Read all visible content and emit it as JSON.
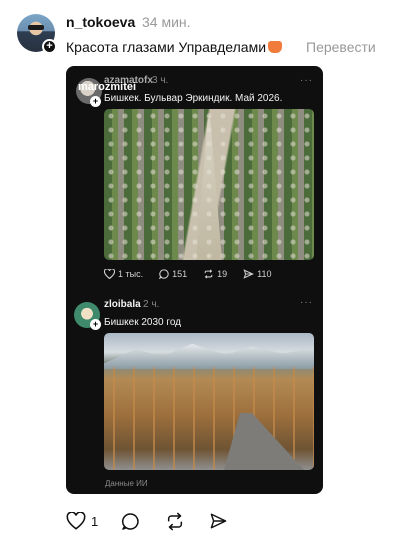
{
  "post": {
    "username": "n_tokoeva",
    "time": "34 мин.",
    "text": "Красота глазами Управделами",
    "translate": "Перевести",
    "plus": "+"
  },
  "embed": {
    "watermark": "marozmitei",
    "quote1": {
      "user": "azamatofx",
      "time": "3 ч.",
      "dots": "···",
      "text": "Бишкек. Бульвар Эркиндик. Май 2026.",
      "likes": "1 тыс.",
      "comments": "151",
      "reposts": "19",
      "shares": "110",
      "plus": "+"
    },
    "quote2": {
      "user": "zloibala",
      "time": "2 ч.",
      "dots": "···",
      "text": "Бишкек 2030 год",
      "plus": "+"
    },
    "ai_label": "Данные ИИ"
  },
  "actions": {
    "likes": "1"
  }
}
